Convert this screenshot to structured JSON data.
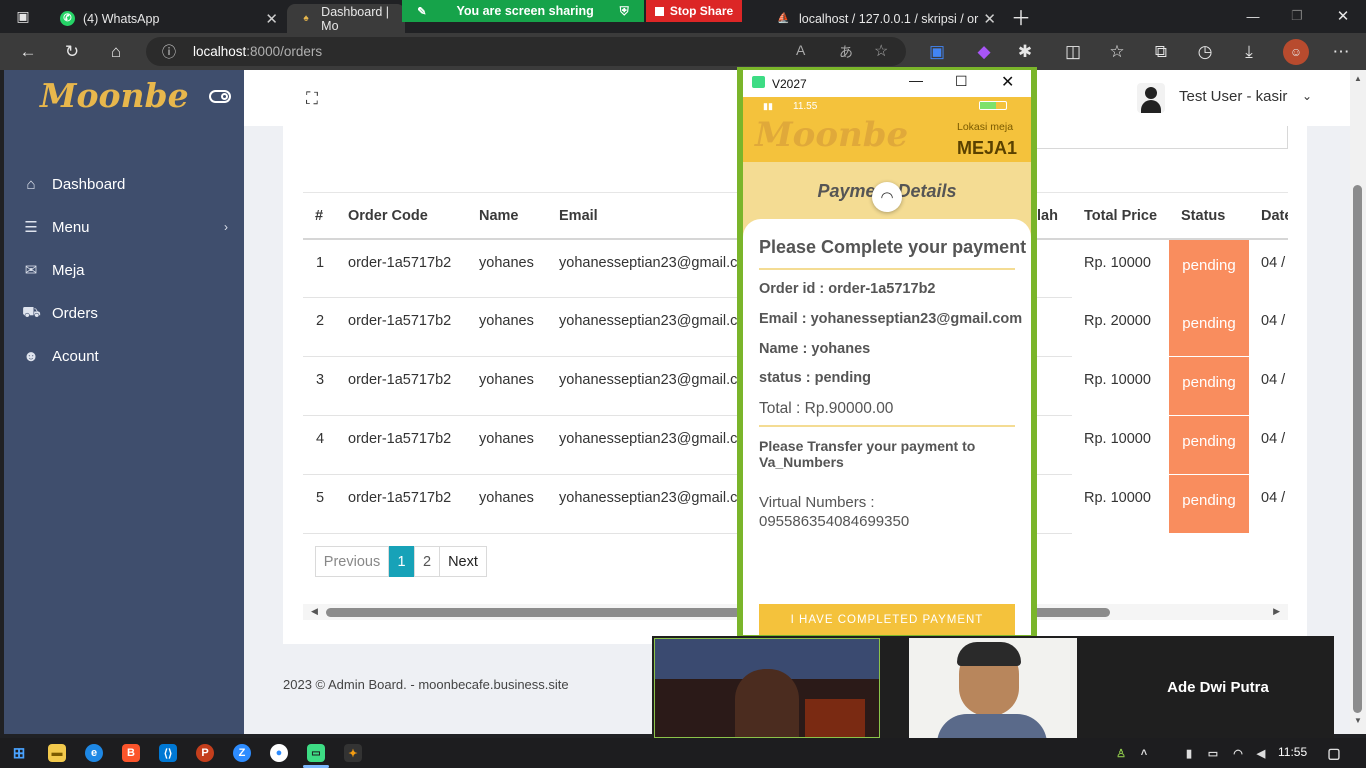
{
  "browser": {
    "tabs": [
      {
        "title": "(4) WhatsApp"
      },
      {
        "title": "Dashboard | Mo"
      },
      {
        "title": "localhost / 127.0.0.1 / skripsi / or"
      }
    ],
    "share_banner": "You are screen sharing",
    "stop_share": "Stop Share",
    "url_host": "localhost",
    "url_path": ":8000/orders"
  },
  "sidebar": {
    "logo": "Moonbe",
    "items": [
      {
        "label": "Dashboard",
        "icon": "home-icon"
      },
      {
        "label": "Menu",
        "icon": "list-icon"
      },
      {
        "label": "Meja",
        "icon": "mail-icon"
      },
      {
        "label": "Orders",
        "icon": "cart-icon"
      },
      {
        "label": "Acount",
        "icon": "users-icon"
      }
    ]
  },
  "header": {
    "user": "Test User - kasir"
  },
  "table": {
    "headers": [
      "#",
      "Order Code",
      "Name",
      "Email",
      "lah",
      "Total Price",
      "Status",
      "Date"
    ],
    "rows": [
      {
        "no": "1",
        "code": "order-1a5717b2",
        "name": "yohanes",
        "email": "yohanesseptian23@gmail.c",
        "total": "Rp. 10000",
        "status": "pending",
        "date": "04 /"
      },
      {
        "no": "2",
        "code": "order-1a5717b2",
        "name": "yohanes",
        "email": "yohanesseptian23@gmail.c",
        "total": "Rp. 20000",
        "status": "pending",
        "date": "04 /"
      },
      {
        "no": "3",
        "code": "order-1a5717b2",
        "name": "yohanes",
        "email": "yohanesseptian23@gmail.c",
        "total": "Rp. 10000",
        "status": "pending",
        "date": "04 /"
      },
      {
        "no": "4",
        "code": "order-1a5717b2",
        "name": "yohanes",
        "email": "yohanesseptian23@gmail.c",
        "total": "Rp. 10000",
        "status": "pending",
        "date": "04 /"
      },
      {
        "no": "5",
        "code": "order-1a5717b2",
        "name": "yohanes",
        "email": "yohanesseptian23@gmail.c",
        "total": "Rp. 10000",
        "status": "pending",
        "date": "04 /"
      }
    ]
  },
  "pagination": {
    "previous": "Previous",
    "page1": "1",
    "page2": "2",
    "next": "Next"
  },
  "footer": "2023 © Admin Board. - moonbecafe.business.site",
  "colors": {
    "sidebar": "#3f4e6d",
    "accent": "#17a2b8",
    "status_pending": "#f98d5e",
    "logo": "#e8b74c"
  },
  "phone_window": {
    "title": "V2027",
    "status_time": "11.55",
    "logo": "Moonbe",
    "location_label": "Lokasi meja",
    "table_name": "MEJA1",
    "heading": "Payment Details",
    "card_title": "Please Complete your payment",
    "order_id": "Order id : order-1a5717b2",
    "email": "Email : yohanesseptian23@gmail.com",
    "name": "Name : yohanes",
    "status": "status : pending",
    "total": "Total : Rp.90000.00",
    "transfer_note": "Please Transfer your payment to Va_Numbers",
    "va_label": "Virtual Numbers :",
    "va_number": "095586354084699350",
    "button": "I HAVE COMPLETED PAYMENT"
  },
  "webcam": {
    "participant": "Ade Dwi Putra"
  },
  "taskbar": {
    "time": "11:55"
  }
}
